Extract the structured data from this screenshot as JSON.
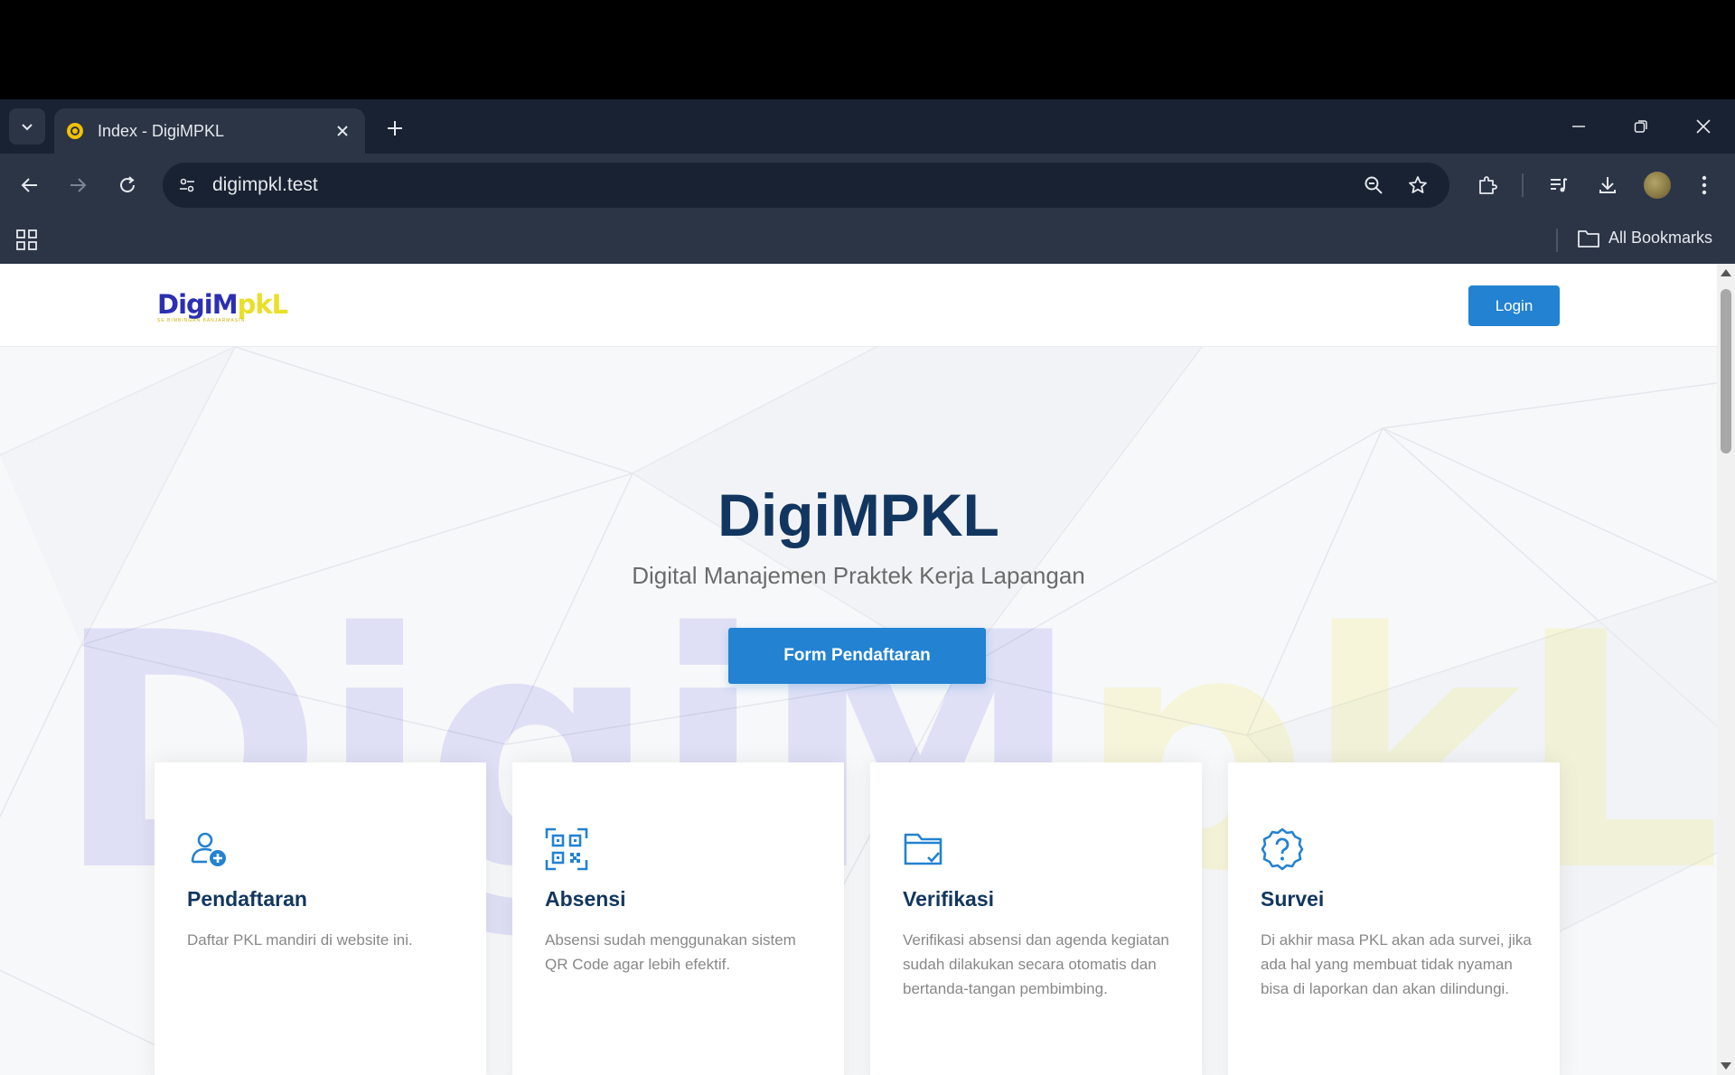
{
  "browser": {
    "tab_title": "Index - DigiMPKL",
    "url": "digimpkl.test",
    "bookmarks_label": "All Bookmarks"
  },
  "header": {
    "logo_part1": "DigiM",
    "logo_part2": "pkL",
    "logo_subtitle": "SE BIMBINGAN BANJARMASIN",
    "login_label": "Login"
  },
  "hero": {
    "title": "DigiMPKL",
    "subtitle": "Digital Manajemen Praktek Kerja Lapangan",
    "cta_label": "Form Pendaftaran",
    "watermark_part1": "DigiM",
    "watermark_part2": "pkL"
  },
  "features": [
    {
      "icon": "user-add-icon",
      "title": "Pendaftaran",
      "description": "Daftar PKL mandiri di website ini."
    },
    {
      "icon": "qr-code-icon",
      "title": "Absensi",
      "description": "Absensi sudah menggunakan sistem QR Code agar lebih efektif."
    },
    {
      "icon": "folder-check-icon",
      "title": "Verifikasi",
      "description": "Verifikasi absensi dan agenda kegiatan sudah dilakukan secara otomatis dan bertanda-tangan pembimbing."
    },
    {
      "icon": "question-badge-icon",
      "title": "Survei",
      "description": "Di akhir masa PKL akan ada survei, jika ada hal yang membuat tidak nyaman bisa di laporkan dan akan dilindungi."
    }
  ],
  "colors": {
    "primary": "#2382d1",
    "heading": "#12365f",
    "chrome_dark": "#182232",
    "chrome": "#2b3546"
  }
}
